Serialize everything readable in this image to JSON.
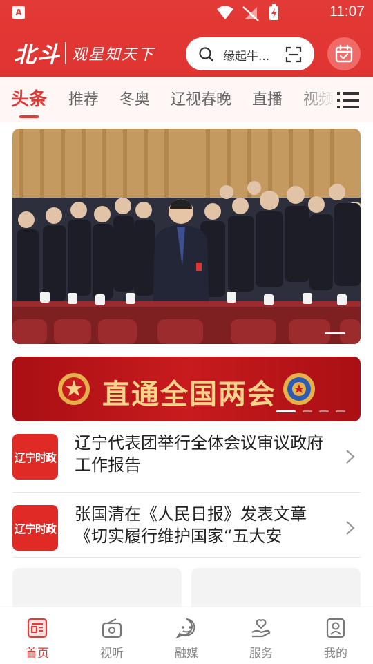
{
  "status_bar": {
    "time": "11:07",
    "notification_icon": "app-a-icon",
    "icons": [
      "wifi-icon",
      "signal-off-icon",
      "battery-charging-icon"
    ]
  },
  "header": {
    "logo_text": "北斗",
    "slogan": "观星知天下",
    "search": {
      "placeholder": "缘起牛...",
      "icon": "search-icon",
      "scan_icon": "scan-icon"
    },
    "calendar_icon": "calendar-check-icon"
  },
  "tabs": [
    {
      "label": "头条",
      "active": true
    },
    {
      "label": "推荐",
      "active": false
    },
    {
      "label": "冬奥",
      "active": false
    },
    {
      "label": "辽视春晚",
      "active": false
    },
    {
      "label": "直播",
      "active": false
    },
    {
      "label": "视频",
      "active": false
    }
  ],
  "tab_menu_icon": "list-menu-icon",
  "hero": {
    "image": "people-applauding-at-assembly-photo",
    "carousel_index": 1
  },
  "banner": {
    "title": "直通全国两会",
    "left_emblem": "national-emblem-icon",
    "right_emblem": "cppcc-emblem-icon"
  },
  "news": [
    {
      "thumb_label": "辽宁时政",
      "title": "辽宁代表团举行全体会议审议政府工作报告"
    },
    {
      "thumb_label": "辽宁时政",
      "title": "张国清在《人民日报》发表文章《切实履行维护国家“五大安"
    }
  ],
  "bottom_nav": [
    {
      "label": "首页",
      "icon": "newspaper-icon",
      "active": true
    },
    {
      "label": "视听",
      "icon": "radio-icon",
      "active": false
    },
    {
      "label": "融媒",
      "icon": "chat-face-icon",
      "active": false
    },
    {
      "label": "服务",
      "icon": "hand-heart-icon",
      "active": false
    },
    {
      "label": "我的",
      "icon": "profile-icon",
      "active": false
    }
  ],
  "colors": {
    "brand_red": "#e23a36",
    "tab_bg": "#fff7f6",
    "banner_gold": "#f6d38b"
  }
}
